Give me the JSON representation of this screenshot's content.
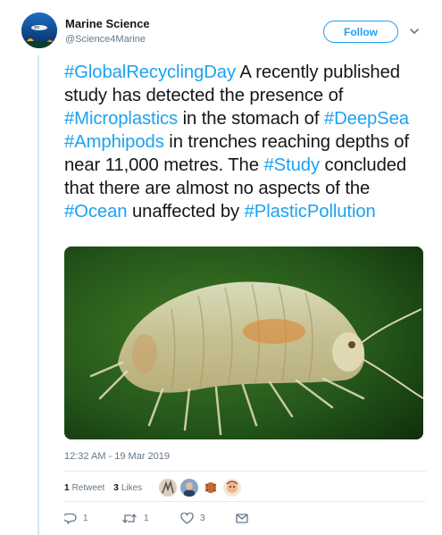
{
  "author": {
    "name": "Marine Science",
    "handle": "@Science4Marine",
    "avatar_icon": "diver-avatar-icon"
  },
  "follow_label": "Follow",
  "tweet": {
    "segments": [
      {
        "text": "#GlobalRecyclingDay",
        "tag": true
      },
      {
        "text": " A recently published study has detected the presence of ",
        "tag": false
      },
      {
        "text": "#Microplastics",
        "tag": true
      },
      {
        "text": " in the stomach of ",
        "tag": false
      },
      {
        "text": "#DeepSea",
        "tag": true
      },
      {
        "text": " ",
        "tag": false
      },
      {
        "text": "#Amphipods",
        "tag": true
      },
      {
        "text": " in trenches reaching depths of near 11,000 metres. The ",
        "tag": false
      },
      {
        "text": "#Study",
        "tag": true
      },
      {
        "text": " concluded that there are almost no aspects of the ",
        "tag": false
      },
      {
        "text": "#Ocean",
        "tag": true
      },
      {
        "text": " unaffected by ",
        "tag": false
      },
      {
        "text": "#PlasticPollution",
        "tag": true
      }
    ]
  },
  "media": {
    "subject": "amphipod-photo"
  },
  "timestamp": "12:32 AM - 19 Mar 2019",
  "stats": {
    "retweets_count": "1",
    "retweets_label": "Retweet",
    "likes_count": "3",
    "likes_label": "Likes"
  },
  "actions": {
    "reply_count": "1",
    "retweet_count": "1",
    "like_count": "3"
  },
  "colors": {
    "accent": "#1da1f2",
    "text": "#14171a",
    "muted": "#657786",
    "thread_line": "#cfe9fa"
  }
}
